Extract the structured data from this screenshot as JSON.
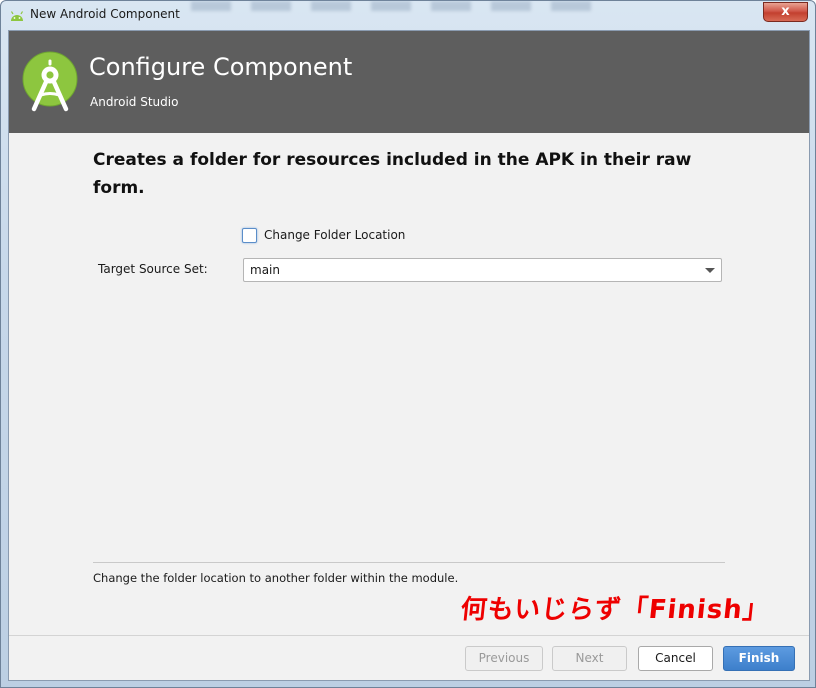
{
  "window": {
    "title": "New Android Component",
    "close_glyph": "x"
  },
  "header": {
    "title": "Configure Component",
    "subtitle": "Android Studio",
    "logo_icon": "android-studio-icon",
    "background_color": "#5e5e5e"
  },
  "form": {
    "description": "Creates a folder for resources included in the APK in their raw form.",
    "change_folder_checkbox": {
      "label": "Change Folder Location",
      "checked": false
    },
    "target_source_set": {
      "label": "Target Source Set:",
      "value": "main"
    }
  },
  "help_text": "Change the folder location to another folder within the module.",
  "annotation": {
    "text": "何もいじらず「Finish」",
    "color": "#ee0000"
  },
  "buttons": {
    "previous": "Previous",
    "next": "Next",
    "cancel": "Cancel",
    "finish": "Finish"
  },
  "colors": {
    "accent": "#3d7fcb",
    "android_green": "#8dc63f"
  }
}
